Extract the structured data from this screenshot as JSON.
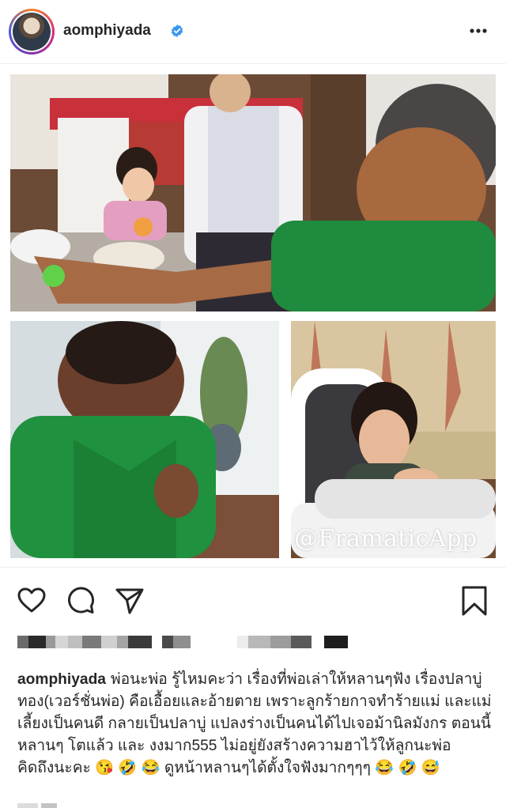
{
  "post": {
    "username": "aomphiyada",
    "watermark": "@FramaticApp",
    "caption": "พ่อนะพ่อ รู้ไหมคะว่า เรื่องที่พ่อเล่าให้หลานๆฟัง เรื่องปลาบู่ทอง(เวอร์ชั่นพ่อ) คือเอื้อยและอ้ายตาย เพราะลูกร้ายกาจทำร้ายแม่ และแม่เลี้ยงเป็นคนดี กลายเป็นปลาบู่ แปลงร่างเป็นคนได้ไปเจอม้านิลมังกร ตอนนี้หลานๆ โตแล้ว และ งงมาก555 ไม่อยู่ยังสร้างความฮาไว้ให้ลูกนะพ่อ คิดถึงนะคะ 😘 🤣 😂 ดูหน้าหลานๆได้ตั้งใจฟังมากๆๆๆ 😂 🤣 😅"
  },
  "icons": {
    "verified": "verified-badge-icon",
    "more": "more-options-icon",
    "like": "heart-icon",
    "comment": "comment-icon",
    "share": "send-icon",
    "save": "bookmark-icon"
  },
  "colors": {
    "verified": "#3897f0",
    "text": "#262626",
    "divider": "#efefef"
  }
}
